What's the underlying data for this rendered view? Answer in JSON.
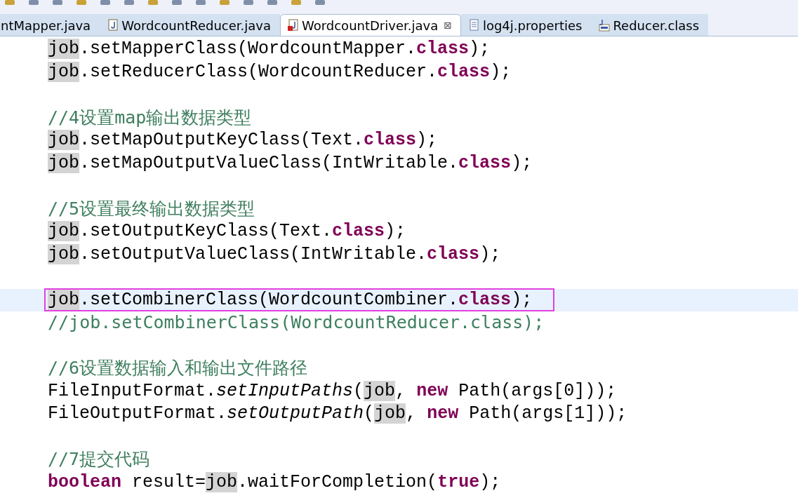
{
  "tabs": [
    {
      "label": "ntMapper.java",
      "selected": false
    },
    {
      "label": "WordcountReducer.java",
      "kind": "java",
      "selected": false
    },
    {
      "label": "WordcountDriver.java",
      "kind": "java",
      "selected": true,
      "error": true,
      "close": "⊠"
    },
    {
      "label": "log4j.properties",
      "kind": "properties",
      "selected": false
    },
    {
      "label": "Reducer.class",
      "kind": "class",
      "selected": false
    }
  ],
  "editor": {
    "lines": [
      {
        "kind": "code",
        "current": false,
        "tokens": [
          {
            "t": "job",
            "kind": "hl"
          },
          {
            "t": ".setMapperClass(WordcountMapper.",
            "kind": "plain"
          },
          {
            "t": "class",
            "kind": "kw"
          },
          {
            "t": ");",
            "kind": "plain"
          }
        ]
      },
      {
        "kind": "code",
        "current": false,
        "tokens": [
          {
            "t": "job",
            "kind": "hl"
          },
          {
            "t": ".setReducerClass(WordcountReducer.",
            "kind": "plain"
          },
          {
            "t": "class",
            "kind": "kw"
          },
          {
            "t": ");",
            "kind": "plain"
          }
        ]
      },
      {
        "kind": "blank",
        "current": false
      },
      {
        "kind": "code",
        "current": false,
        "tokens": [
          {
            "t": "//4设置map输出数据类型",
            "kind": "comment"
          }
        ]
      },
      {
        "kind": "code",
        "current": false,
        "tokens": [
          {
            "t": "job",
            "kind": "hl"
          },
          {
            "t": ".setMapOutputKeyClass(Text.",
            "kind": "plain"
          },
          {
            "t": "class",
            "kind": "kw"
          },
          {
            "t": ");",
            "kind": "plain"
          }
        ]
      },
      {
        "kind": "code",
        "current": false,
        "tokens": [
          {
            "t": "job",
            "kind": "hl"
          },
          {
            "t": ".setMapOutputValueClass(IntWritable.",
            "kind": "plain"
          },
          {
            "t": "class",
            "kind": "kw"
          },
          {
            "t": ");",
            "kind": "plain"
          }
        ]
      },
      {
        "kind": "blank",
        "current": false
      },
      {
        "kind": "code",
        "current": false,
        "tokens": [
          {
            "t": "//5设置最终输出数据类型",
            "kind": "comment"
          }
        ]
      },
      {
        "kind": "code",
        "current": false,
        "tokens": [
          {
            "t": "job",
            "kind": "hl"
          },
          {
            "t": ".setOutputKeyClass(Text.",
            "kind": "plain"
          },
          {
            "t": "class",
            "kind": "kw"
          },
          {
            "t": ");",
            "kind": "plain"
          }
        ]
      },
      {
        "kind": "code",
        "current": false,
        "tokens": [
          {
            "t": "job",
            "kind": "hl"
          },
          {
            "t": ".setOutputValueClass(IntWritable.",
            "kind": "plain"
          },
          {
            "t": "class",
            "kind": "kw"
          },
          {
            "t": ");",
            "kind": "plain"
          }
        ]
      },
      {
        "kind": "blank",
        "current": false
      },
      {
        "kind": "code",
        "current": true,
        "boxed": true,
        "tokens": [
          {
            "t": "job",
            "kind": "hl"
          },
          {
            "t": ".setCombinerClass(WordcountCombiner.",
            "kind": "plain"
          },
          {
            "t": "class",
            "kind": "kw"
          },
          {
            "t": ");",
            "kind": "plain"
          }
        ]
      },
      {
        "kind": "code",
        "current": false,
        "tokens": [
          {
            "t": "//job.setCombinerClass(WordcountReducer.class);",
            "kind": "comment"
          }
        ]
      },
      {
        "kind": "blank",
        "current": false
      },
      {
        "kind": "code",
        "current": false,
        "tokens": [
          {
            "t": "//6设置数据输入和输出文件路径",
            "kind": "comment"
          }
        ]
      },
      {
        "kind": "code",
        "current": false,
        "tokens": [
          {
            "t": "FileInputFormat.",
            "kind": "plain"
          },
          {
            "t": "setInputPaths",
            "kind": "italic"
          },
          {
            "t": "(",
            "kind": "plain"
          },
          {
            "t": "job",
            "kind": "hl"
          },
          {
            "t": ", ",
            "kind": "plain"
          },
          {
            "t": "new",
            "kind": "kw"
          },
          {
            "t": " Path(args[0]));",
            "kind": "plain"
          }
        ]
      },
      {
        "kind": "code",
        "current": false,
        "tokens": [
          {
            "t": "FileOutputFormat.",
            "kind": "plain"
          },
          {
            "t": "setOutputPath",
            "kind": "italic"
          },
          {
            "t": "(",
            "kind": "plain"
          },
          {
            "t": "job",
            "kind": "hl"
          },
          {
            "t": ", ",
            "kind": "plain"
          },
          {
            "t": "new",
            "kind": "kw"
          },
          {
            "t": " Path(args[1]));",
            "kind": "plain"
          }
        ]
      },
      {
        "kind": "blank",
        "current": false
      },
      {
        "kind": "code",
        "current": false,
        "tokens": [
          {
            "t": "//7提交代码",
            "kind": "comment"
          }
        ]
      },
      {
        "kind": "code",
        "current": false,
        "tokens": [
          {
            "t": "boolean",
            "kind": "kw"
          },
          {
            "t": " result=",
            "kind": "plain"
          },
          {
            "t": "job",
            "kind": "hl"
          },
          {
            "t": ".waitForCompletion(",
            "kind": "plain"
          },
          {
            "t": "true",
            "kind": "kw"
          },
          {
            "t": ");",
            "kind": "plain"
          }
        ]
      }
    ]
  }
}
